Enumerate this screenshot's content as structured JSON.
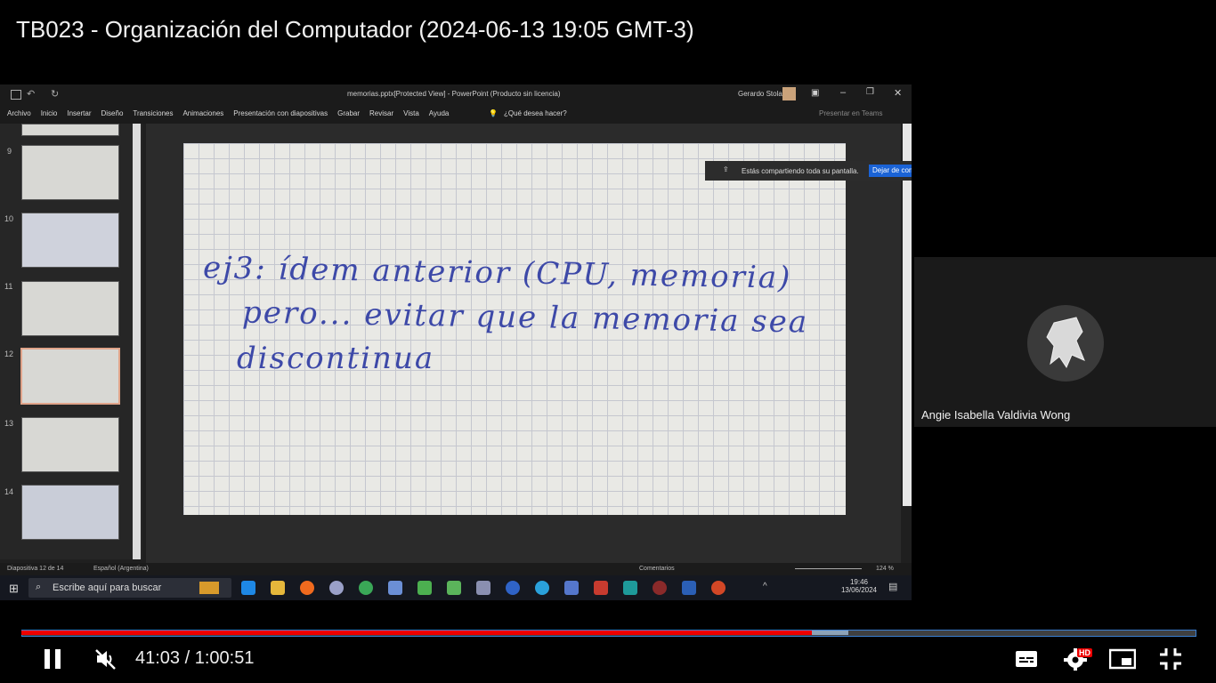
{
  "video": {
    "title": "TB023 - Organización del Computador (2024-06-13 19:05 GMT-3)",
    "current_time": "41:03",
    "separator": " / ",
    "duration": "1:00:51",
    "progress_fraction": 0.674,
    "buffered_fraction": 0.705,
    "quality_badge": "HD"
  },
  "powerpoint": {
    "window_title": "memorias.pptx[Protected View]  -  PowerPoint (Producto sin licencia)",
    "user_name": "Gerardo Stola",
    "ribbon_tabs": [
      "Archivo",
      "Inicio",
      "Insertar",
      "Diseño",
      "Transiciones",
      "Animaciones",
      "Presentación con diapositivas",
      "Grabar",
      "Revisar",
      "Vista",
      "Ayuda"
    ],
    "tell_me": "¿Qué desea hacer?",
    "teams": "Presentar en Teams",
    "slide_numbers": [
      "9",
      "10",
      "11",
      "12",
      "13",
      "14"
    ],
    "selected_slide": "12",
    "status_slide": "Diapositiva 12 de 14",
    "status_language": "Español (Argentina)",
    "status_comments": "Comentarios",
    "zoom": "124 %",
    "slide_text": {
      "line1": "ej3: ídem anterior (CPU, memoria)",
      "line2": "pero... evitar que la memoria sea",
      "line3": "discontinua"
    }
  },
  "screen_share": {
    "message": "Estás compartiendo toda su pantalla.",
    "stop_button": "Dejar de compartir"
  },
  "taskbar": {
    "search_placeholder": "Escribe aquí para buscar",
    "time": "19:46",
    "date": "13/06/2024"
  },
  "participant": {
    "name": "Angie Isabella Valdivia Wong"
  },
  "colors": {
    "progress_played": "#ff0000",
    "accent_blue": "#3b7fd1",
    "handwriting": "#3d49a8"
  }
}
